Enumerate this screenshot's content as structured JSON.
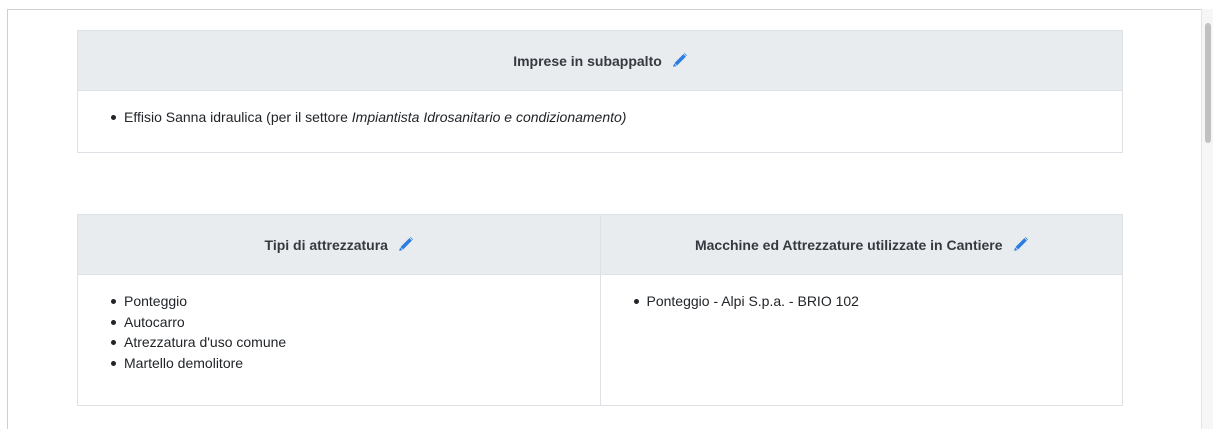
{
  "subcontractors_card": {
    "title": "Imprese in subappalto",
    "items": [
      {
        "name": "Effisio Sanna idraulica",
        "prefix": " (per il settore ",
        "sector": "Impiantista Idrosanitario e condizionamento)",
        "suffix": ""
      }
    ]
  },
  "equipment_card": {
    "left": {
      "title": "Tipi di attrezzatura",
      "items": [
        "Ponteggio",
        "Autocarro",
        "Atrezzatura d'uso comune",
        "Martello demolitore"
      ]
    },
    "right": {
      "title": "Macchine ed Attrezzature utilizzate in Cantiere",
      "items": [
        "Ponteggio - Alpi S.p.a. - BRIO 102"
      ]
    }
  },
  "icons": {
    "edit": "pencil-icon",
    "accent_color": "#2a7de1"
  }
}
